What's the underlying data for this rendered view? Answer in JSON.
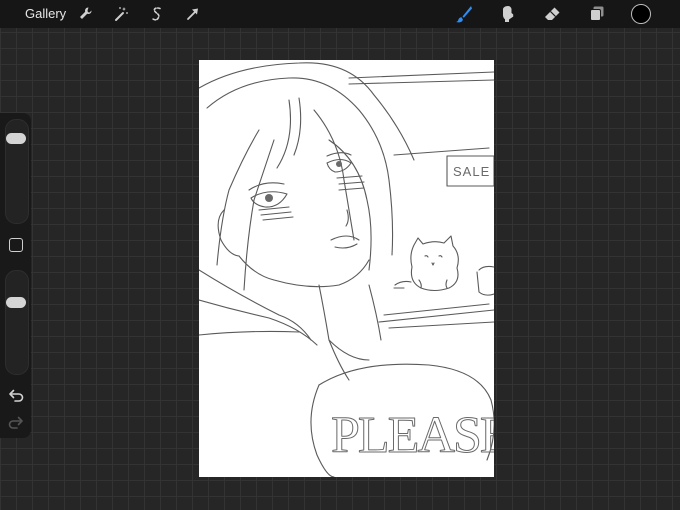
{
  "topbar": {
    "gallery_label": "Gallery",
    "actions": [
      {
        "name": "wrench-icon",
        "label": "Actions"
      },
      {
        "name": "magic-wand-icon",
        "label": "Adjustments"
      },
      {
        "name": "selection-icon",
        "label": "Selection"
      },
      {
        "name": "transform-arrow-icon",
        "label": "Transform"
      }
    ],
    "tools": [
      {
        "name": "brush-icon",
        "label": "Paint",
        "active": true
      },
      {
        "name": "smudge-icon",
        "label": "Smudge",
        "active": false
      },
      {
        "name": "eraser-icon",
        "label": "Erase",
        "active": false
      },
      {
        "name": "layers-icon",
        "label": "Layers",
        "active": false
      }
    ],
    "current_color": "#000000"
  },
  "sidebar": {
    "brush_size_level": 0.88,
    "brush_opacity_level": 0.73
  },
  "canvas": {
    "sign_text": "SALE",
    "speech_text": "PLEASE!"
  },
  "colors": {
    "active_tool": "#2f8ef5",
    "toolbar_bg": "#161616",
    "canvas_bg": "#ffffff",
    "sketch_line": "#5a5a5a"
  }
}
